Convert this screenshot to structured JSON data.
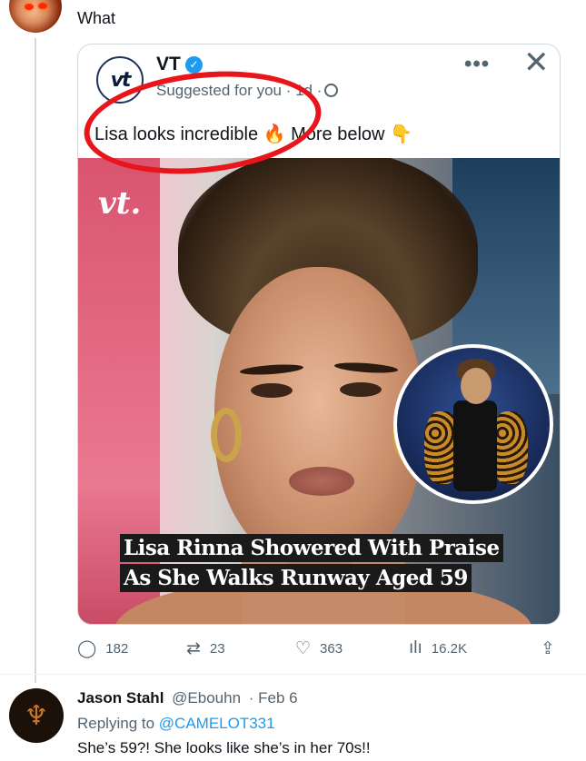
{
  "top_post": {
    "text": "What"
  },
  "quoted": {
    "account_name": "VT",
    "avatar_text": "vt",
    "verified": true,
    "meta": "Suggested for you · 1d ·",
    "text": "Lisa looks incredible 🔥 More below 👇",
    "brand_logo": "vt.",
    "headline_lines": [
      "Lisa Rinna Showered With Praise",
      "As She Walks Runway Aged 59"
    ],
    "more_icon": "more-dots-icon",
    "close_icon": "close-icon"
  },
  "actions": {
    "reply_count": "182",
    "retweet_count": "23",
    "like_count": "363",
    "views_count": "16.2K"
  },
  "reply": {
    "name": "Jason Stahl",
    "handle": "@Ebouhn",
    "date": "· Feb 6",
    "replying_label": "Replying to",
    "replying_mention": "@CAMELOT331",
    "text": "She’s 59?! She looks like she’s in her 70s!!"
  },
  "colors": {
    "annotation_red": "#e8151b",
    "link_blue": "#1d9bf0",
    "secondary_text": "#536471"
  }
}
